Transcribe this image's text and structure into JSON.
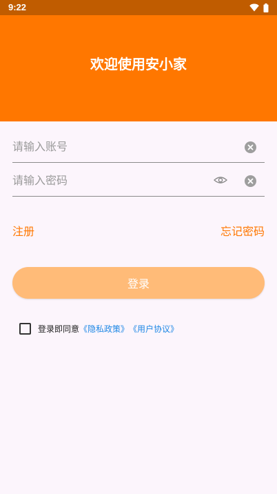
{
  "status_bar": {
    "time": "9:22",
    "icons": [
      "wifi-icon",
      "battery-icon"
    ]
  },
  "header": {
    "title": "欢迎使用安小家",
    "color": "#FF7700"
  },
  "form": {
    "account_placeholder": "请输入账号",
    "account_value": "",
    "password_placeholder": "请输入密码",
    "password_value": ""
  },
  "links": {
    "register": "注册",
    "forgot_password": "忘记密码"
  },
  "login_button": {
    "label": "登录",
    "color": "#FFBB78"
  },
  "agreement": {
    "checked": false,
    "text": "登录即同意",
    "privacy_link": "《隐私政策》",
    "user_link": "《用户协议》",
    "link_color": "#1E88E5"
  }
}
